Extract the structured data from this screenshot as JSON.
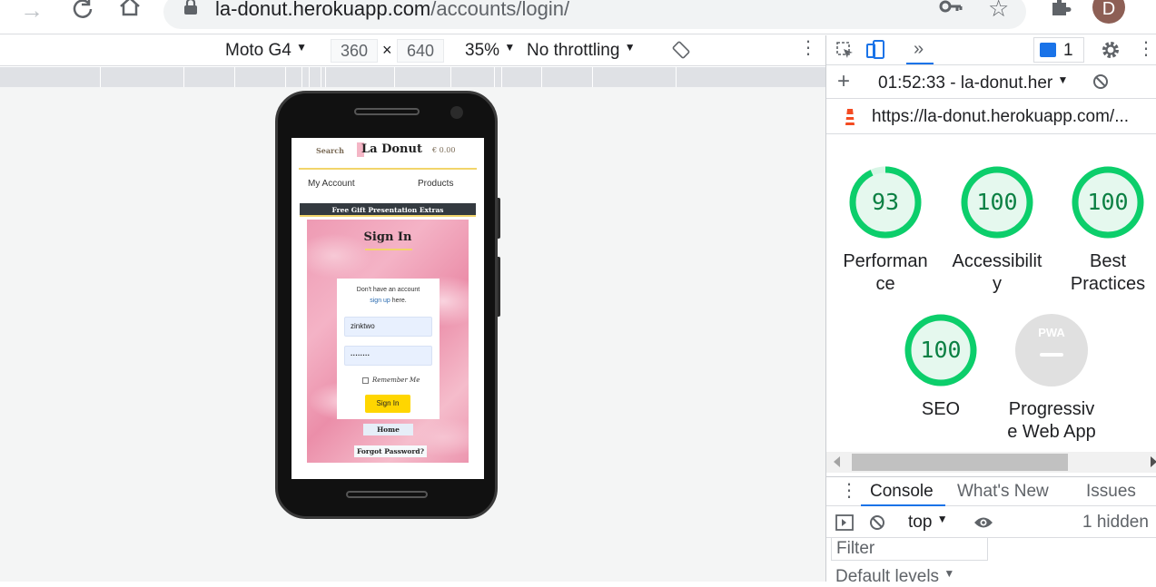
{
  "browser": {
    "url_host": "la-donut.herokuapp.com",
    "url_path": "/accounts/login/",
    "avatar_letter": "D"
  },
  "device_toolbar": {
    "device": "Moto G4",
    "width": "360",
    "times": "×",
    "height": "640",
    "zoom": "35%",
    "throttling": "No throttling"
  },
  "site": {
    "search": "Search",
    "logo": "La Donut",
    "cart": "€ 0.00",
    "nav_account": "My Account",
    "nav_products": "Products",
    "ribbon": "Free Gift Presentation Extras",
    "signin_title": "Sign In",
    "no_account_text": "Don't have an account",
    "signup_link": "sign up",
    "signup_suffix": " here.",
    "username_value": "zinktwo",
    "password_value": "········",
    "remember_me": "Remember Me",
    "signin_button": "Sign In",
    "home_button": "Home",
    "forgot_password": "Forgot Password?"
  },
  "devtools": {
    "issues_count": "1",
    "report_time": "01:52:33 - la-donut.her",
    "report_url": "https://la-donut.herokuapp.com/...",
    "scores": [
      {
        "value": "93",
        "label_line1": "Performan",
        "label_line2": "ce"
      },
      {
        "value": "100",
        "label_line1": "Accessibilit",
        "label_line2": "y"
      },
      {
        "value": "100",
        "label_line1": "Best",
        "label_line2": "Practices"
      },
      {
        "value": "100",
        "label_line1": "SEO",
        "label_line2": ""
      },
      {
        "value": "",
        "label_line1": "Progressiv",
        "label_line2": "e Web App"
      }
    ],
    "pwa_badge": "PWA",
    "drawer_tabs": [
      "Console",
      "What's New",
      "Issues"
    ],
    "context": "top",
    "hidden_count": "1 hidden",
    "filter_placeholder": "Filter",
    "levels": "Default levels"
  },
  "colors": {
    "score_green": "#0cce6b",
    "score_text": "#0b8043",
    "accent_blue": "#1a73e8",
    "gold": "#f2d46a",
    "button_yellow": "#ffd600"
  }
}
